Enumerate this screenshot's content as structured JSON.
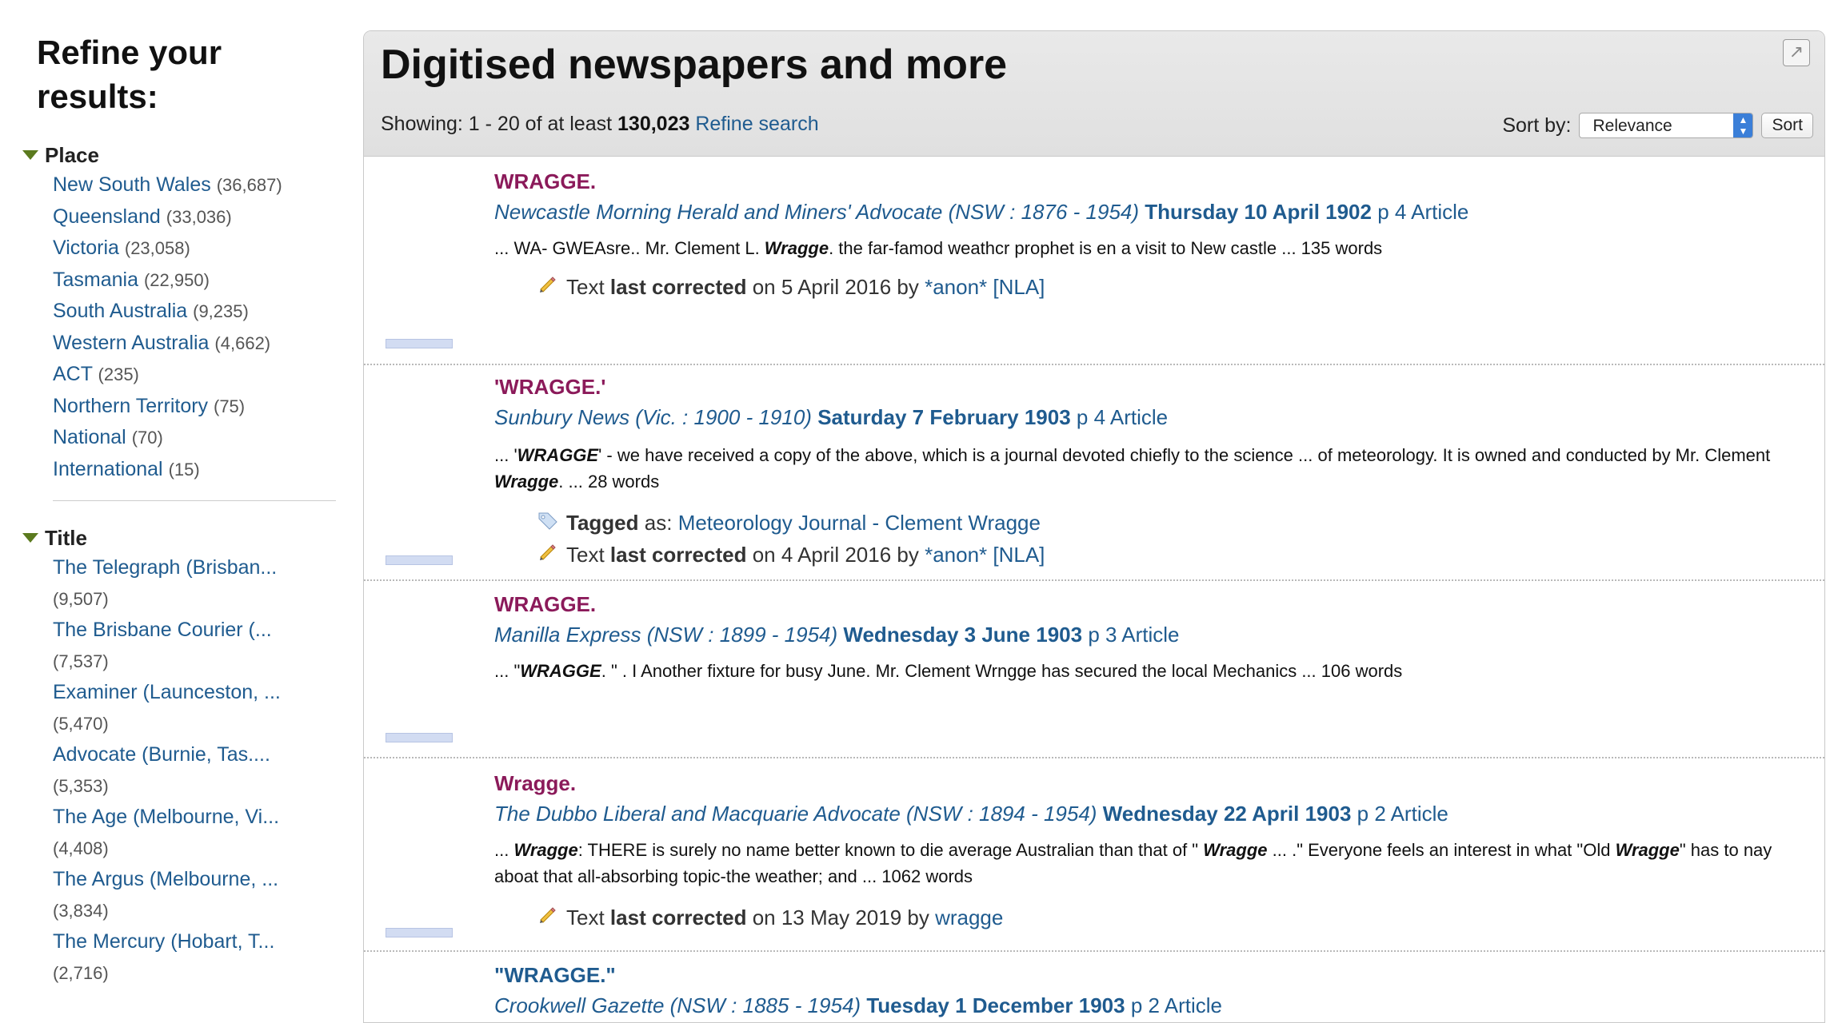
{
  "sidebar": {
    "title": "Refine your results:",
    "place": {
      "heading": "Place",
      "items": [
        {
          "label": "New South Wales",
          "count": "(36,687)"
        },
        {
          "label": "Queensland",
          "count": "(33,036)"
        },
        {
          "label": "Victoria",
          "count": "(23,058)"
        },
        {
          "label": "Tasmania",
          "count": "(22,950)"
        },
        {
          "label": "South Australia",
          "count": "(9,235)"
        },
        {
          "label": "Western Australia",
          "count": "(4,662)"
        },
        {
          "label": "ACT",
          "count": "(235)"
        },
        {
          "label": "Northern Territory",
          "count": "(75)"
        },
        {
          "label": "National",
          "count": "(70)"
        },
        {
          "label": "International",
          "count": "(15)"
        }
      ]
    },
    "title_facet": {
      "heading": "Title",
      "items": [
        {
          "label": "The Telegraph (Brisban...",
          "count": "(9,507)"
        },
        {
          "label": "The Brisbane Courier (...",
          "count": "(7,537)"
        },
        {
          "label": "Examiner (Launceston, ...",
          "count": "(5,470)"
        },
        {
          "label": "Advocate (Burnie, Tas....",
          "count": "(5,353)"
        },
        {
          "label": "The Age (Melbourne, Vi...",
          "count": "(4,408)"
        },
        {
          "label": "The Argus (Melbourne, ...",
          "count": "(3,834)"
        },
        {
          "label": "The Mercury (Hobart, T...",
          "count": "(2,716)"
        }
      ]
    }
  },
  "main": {
    "heading": "Digitised newspapers and more",
    "showing_prefix": "Showing: 1 - 20 of at least",
    "total": "130,023",
    "refine_link": "Refine search",
    "sort_label": "Sort by:",
    "sort_value": "Relevance",
    "sort_button": "Sort"
  },
  "results": [
    {
      "title": "WRAGGE.",
      "source": "Newcastle Morning Herald and Miners' Advocate (NSW : 1876 - 1954)",
      "date": "Thursday 10 April 1902",
      "page": "p 4 Article",
      "snippet_a": "... WA- GWEAsre.. Mr. Clement L. ",
      "snippet_em": "Wragge",
      "snippet_b": ". the far-famod weathcr prophet is en a visit to New castle ... 135 words",
      "corrected_text": "Text",
      "corrected_bold": "last corrected",
      "corrected_on": "on 5 April 2016 by",
      "corrected_by": "*anon* [NLA]"
    },
    {
      "title": "'WRAGGE.'",
      "source": "Sunbury News (Vic. : 1900 - 1910)",
      "date": "Saturday 7 February 1903",
      "page": "p 4 Article",
      "snippet_a": "... '",
      "snippet_em": "WRAGGE",
      "snippet_b": "' - we have received a copy of the above, which is a journal devoted chiefly to the science ... of meteorology. It is owned and conducted by Mr. Clement ",
      "snippet_em2": "Wragge",
      "snippet_c": ". ... 28 words",
      "tagged_bold": "Tagged",
      "tagged_as": "as:",
      "tag": "Meteorology Journal - Clement Wragge",
      "corrected_text": "Text",
      "corrected_bold": "last corrected",
      "corrected_on": "on 4 April 2016 by",
      "corrected_by": "*anon* [NLA]"
    },
    {
      "title": "WRAGGE.",
      "source": "Manilla Express (NSW : 1899 - 1954)",
      "date": "Wednesday 3 June 1903",
      "page": "p 3 Article",
      "snippet_a": "... \"",
      "snippet_em": "WRAGGE",
      "snippet_b": ". \" . I Another fixture for busy June. Mr. Clement Wrngge has secured the local Mechanics ... 106 words"
    },
    {
      "title": "Wragge.",
      "source": "The Dubbo Liberal and Macquarie Advocate (NSW : 1894 - 1954)",
      "date": "Wednesday 22 April 1903",
      "page": "p 2 Article",
      "snippet_a": "... ",
      "snippet_em": "Wragge",
      "snippet_b": ": THERE is surely no name better known to die average Australian than that of \" ",
      "snippet_em2": "Wragge",
      "snippet_c": " ... .\" Everyone feels an interest in what \"Old ",
      "snippet_em3": "Wragge",
      "snippet_d": "\" has to nay aboat that all-absorbing topic-the weather; and ... 1062 words",
      "corrected_text": "Text",
      "corrected_bold": "last corrected",
      "corrected_on": "on 13 May 2019 by",
      "corrected_by": "wragge"
    },
    {
      "title": "\"WRAGGE.\"",
      "source": "Crookwell Gazette (NSW : 1885 - 1954)",
      "date": "Tuesday 1 December 1903",
      "page": "p 2 Article"
    }
  ]
}
